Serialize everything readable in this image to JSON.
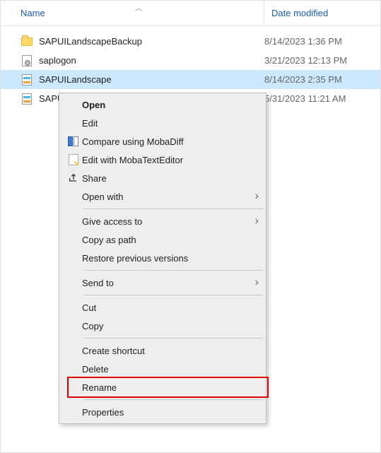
{
  "columns": {
    "name": "Name",
    "date": "Date modified"
  },
  "files": [
    {
      "name": "SAPUILandscapeBackup",
      "date": "8/14/2023 1:36 PM",
      "type": "folder",
      "selected": false
    },
    {
      "name": "saplogon",
      "date": "3/21/2023 12:13 PM",
      "type": "ini",
      "selected": false
    },
    {
      "name": "SAPUILandscape",
      "date": "8/14/2023 2:35 PM",
      "type": "xml",
      "selected": true
    },
    {
      "name": "SAPUILandscapeCore",
      "date": "5/31/2023 11:21 AM",
      "type": "xml",
      "selected": false
    }
  ],
  "contextMenu": {
    "open": "Open",
    "edit": "Edit",
    "compare": "Compare using MobaDiff",
    "editMoba": "Edit with MobaTextEditor",
    "share": "Share",
    "openWith": "Open with",
    "giveAccess": "Give access to",
    "copyPath": "Copy as path",
    "restore": "Restore previous versions",
    "sendTo": "Send to",
    "cut": "Cut",
    "copy": "Copy",
    "shortcut": "Create shortcut",
    "delete": "Delete",
    "rename": "Rename",
    "properties": "Properties"
  }
}
